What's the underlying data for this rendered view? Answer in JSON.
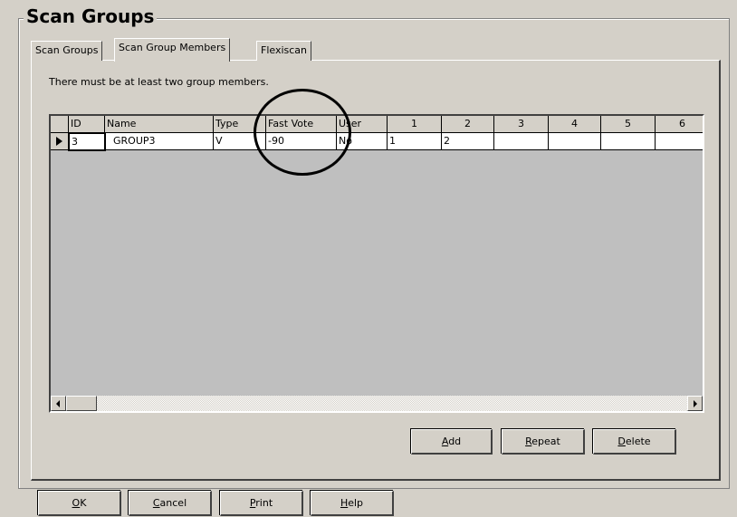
{
  "window": {
    "title": "Scan Groups"
  },
  "tabs": [
    {
      "label": "Scan Groups"
    },
    {
      "label": "Scan Group Members",
      "active": true
    },
    {
      "label": "Flexiscan"
    }
  ],
  "notice": "There must be at least two group members.",
  "grid": {
    "headers": [
      "ID",
      "Name",
      "Type",
      "Fast Vote",
      "User",
      "1",
      "2",
      "3",
      "4",
      "5",
      "6"
    ],
    "rows": [
      [
        "3",
        "  GROUP3",
        "V",
        "-90",
        "No",
        "1",
        "2",
        "",
        "",
        "",
        ""
      ]
    ]
  },
  "panel_buttons": {
    "add": {
      "mnemonic": "A",
      "rest": "dd"
    },
    "repeat": {
      "mnemonic": "R",
      "rest": "epeat"
    },
    "delete": {
      "mnemonic": "D",
      "rest": "elete"
    }
  },
  "dialog_buttons": {
    "ok": {
      "mnemonic": "O",
      "rest": "K"
    },
    "cancel": {
      "mnemonic": "C",
      "rest": "ancel"
    },
    "print": {
      "mnemonic": "P",
      "rest": "rint"
    },
    "help": {
      "mnemonic": "H",
      "rest": "elp"
    }
  },
  "colors": {
    "face": "#d4d0c8",
    "grid_background": "#bfbfbf",
    "annotation": "#000000"
  }
}
